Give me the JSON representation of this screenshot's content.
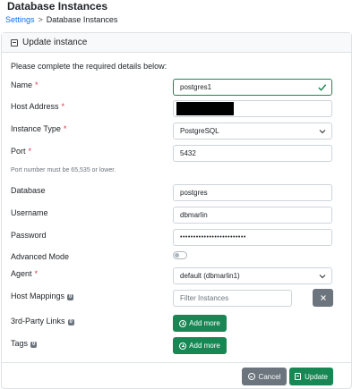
{
  "page": {
    "title": "Database Instances"
  },
  "breadcrumb": {
    "parent": "Settings",
    "separator": ">",
    "current": "Database Instances"
  },
  "card": {
    "header": "Update instance",
    "intro": "Please complete the required details below:"
  },
  "form": {
    "name": {
      "label": "Name",
      "required_mark": "*",
      "value": "postgres1"
    },
    "host_address": {
      "label": "Host Address",
      "required_mark": "*"
    },
    "instance_type": {
      "label": "Instance Type",
      "required_mark": "*",
      "value": "PostgreSQL"
    },
    "port": {
      "label": "Port",
      "required_mark": "*",
      "value": "5432",
      "hint": "Port number must be 65,535 or lower."
    },
    "database": {
      "label": "Database",
      "value": "postgres"
    },
    "username": {
      "label": "Username",
      "value": "dbmarlin"
    },
    "password": {
      "label": "Password",
      "value": "•••••••••••••••••••••••••"
    },
    "advanced_mode": {
      "label": "Advanced Mode",
      "enabled": false
    },
    "agent": {
      "label": "Agent",
      "required_mark": "*",
      "value": "default (dbmarlin1)"
    },
    "host_mappings": {
      "label": "Host Mappings",
      "count": "0",
      "placeholder": "Filter Instances"
    },
    "third_party_links": {
      "label": "3rd-Party Links",
      "count": "0",
      "add_label": "Add more"
    },
    "tags": {
      "label": "Tags",
      "count": "0",
      "add_label": "Add more"
    }
  },
  "actions": {
    "cancel_label": "Cancel",
    "update_label": "Update"
  },
  "colors": {
    "primary_link": "#0d6efd",
    "success": "#198754",
    "secondary": "#6c757d",
    "required": "#dc3545"
  }
}
